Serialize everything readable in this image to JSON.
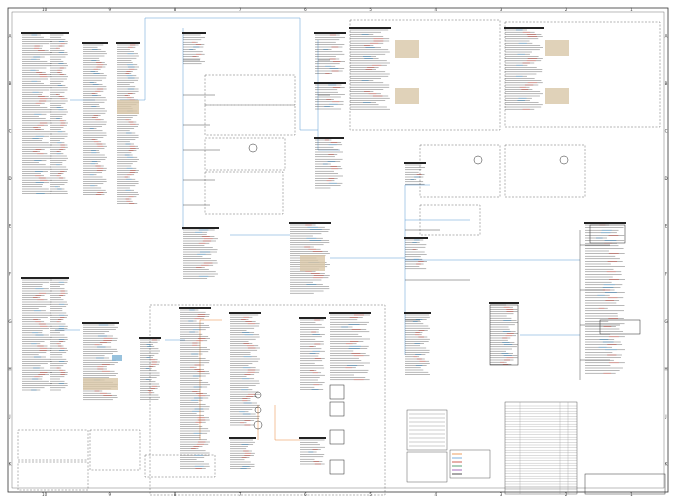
{
  "sheet": {
    "columns": [
      "10",
      "9",
      "8",
      "7",
      "6",
      "5",
      "4",
      "3",
      "2",
      "1"
    ],
    "rows": [
      "A",
      "B",
      "C",
      "D",
      "E",
      "F",
      "G",
      "H",
      "J",
      "K"
    ]
  },
  "connectors": [],
  "colors": {
    "wire_main": "#5b9bd5",
    "wire_alt": "#e8873a",
    "line": "#222222",
    "highlight": "#d9c7a8",
    "accent_blue": "#1f77b4"
  }
}
